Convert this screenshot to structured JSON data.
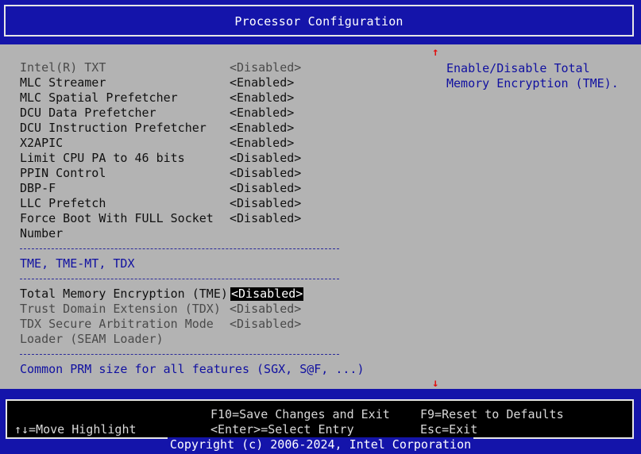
{
  "title": "Processor Configuration",
  "settings": [
    {
      "label": "Intel(R) TXT",
      "value": "<Disabled>",
      "state": "grayed"
    },
    {
      "label": "MLC Streamer",
      "value": "<Enabled>",
      "state": "normal"
    },
    {
      "label": "MLC Spatial Prefetcher",
      "value": "<Enabled>",
      "state": "normal"
    },
    {
      "label": "DCU Data Prefetcher",
      "value": "<Enabled>",
      "state": "normal"
    },
    {
      "label": "DCU Instruction Prefetcher",
      "value": "<Enabled>",
      "state": "normal"
    },
    {
      "label": "X2APIC",
      "value": "<Enabled>",
      "state": "normal"
    },
    {
      "label": "Limit CPU PA to 46 bits",
      "value": "<Disabled>",
      "state": "normal"
    },
    {
      "label": "PPIN Control",
      "value": "<Disabled>",
      "state": "normal"
    },
    {
      "label": "DBP-F",
      "value": "<Disabled>",
      "state": "normal"
    },
    {
      "label": "LLC Prefetch",
      "value": "<Disabled>",
      "state": "normal"
    },
    {
      "label": "Force Boot With FULL Socket",
      "label2": "Number",
      "value": "<Disabled>",
      "state": "normal"
    }
  ],
  "tme_section": "TME, TME-MT, TDX",
  "tme_settings": [
    {
      "label": "Total Memory Encryption (TME)",
      "value": "<Disabled>",
      "state": "selected"
    },
    {
      "label": "Trust Domain Extension (TDX)",
      "value": "<Disabled>",
      "state": "grayed"
    },
    {
      "label": "TDX Secure Arbitration Mode",
      "label2": "Loader (SEAM Loader)",
      "value": "<Disabled>",
      "state": "grayed"
    }
  ],
  "prm_link": "Common PRM size for all features (SGX, S@F, ...)",
  "help_text": "Enable/Disable Total Memory Encryption (TME).",
  "scroll_up": "↑",
  "scroll_down": "↓",
  "footer": {
    "move": "↑↓=Move Highlight",
    "save": "F10=Save Changes and Exit",
    "enter": "<Enter>=Select Entry",
    "reset": "F9=Reset to Defaults",
    "esc": "Esc=Exit"
  },
  "copyright": "Copyright (c) 2006-2024, Intel Corporation",
  "colors": {
    "frame_blue": "#1414aa",
    "panel_gray": "#b3b3b3",
    "help_blue": "#1010a0",
    "arrow_red": "#e01010"
  }
}
